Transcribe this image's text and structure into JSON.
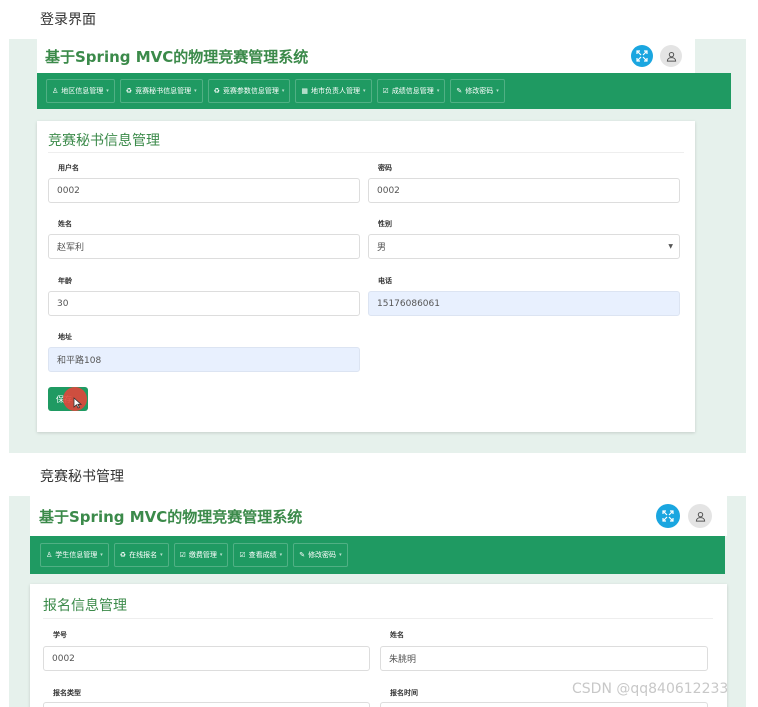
{
  "captions": {
    "first": "登录界面",
    "second": "竞赛秘书管理"
  },
  "watermark": "CSDN @qq840612233",
  "screen1": {
    "app_title": "基于Spring MVC的物理竞赛管理系统",
    "nav": [
      {
        "label": "地区信息管理",
        "icon": "user-icon"
      },
      {
        "label": "竞赛秘书信息管理",
        "icon": "recycle-icon"
      },
      {
        "label": "竞赛参数信息管理",
        "icon": "recycle-icon"
      },
      {
        "label": "地市负责人管理",
        "icon": "list-icon"
      },
      {
        "label": "成绩信息管理",
        "icon": "edit-icon"
      },
      {
        "label": "修改密码",
        "icon": "pencil-icon"
      }
    ],
    "panel_title": "竞赛秘书信息管理",
    "fields": {
      "username": {
        "label": "用户名",
        "value": "0002"
      },
      "password": {
        "label": "密码",
        "value": "0002"
      },
      "name": {
        "label": "姓名",
        "value": "赵军利"
      },
      "gender": {
        "label": "性别",
        "value": "男"
      },
      "age": {
        "label": "年龄",
        "value": "30"
      },
      "phone": {
        "label": "电话",
        "value": "15176086061"
      },
      "address": {
        "label": "地址",
        "value": "和平路108"
      }
    },
    "save_label": "保存"
  },
  "screen2": {
    "app_title": "基于Spring MVC的物理竞赛管理系统",
    "nav": [
      {
        "label": "学生信息管理",
        "icon": "user-icon"
      },
      {
        "label": "在线报名",
        "icon": "recycle-icon"
      },
      {
        "label": "缴费管理",
        "icon": "edit-icon"
      },
      {
        "label": "查看成绩",
        "icon": "edit-icon"
      },
      {
        "label": "修改密码",
        "icon": "pencil-icon"
      }
    ],
    "panel_title": "报名信息管理",
    "fields": {
      "student_id": {
        "label": "学号",
        "value": "0002"
      },
      "name": {
        "label": "姓名",
        "value": "朱朓明"
      },
      "reg_type": {
        "label": "报名类型",
        "value": ""
      },
      "reg_time": {
        "label": "报名时间",
        "value": ""
      }
    }
  }
}
